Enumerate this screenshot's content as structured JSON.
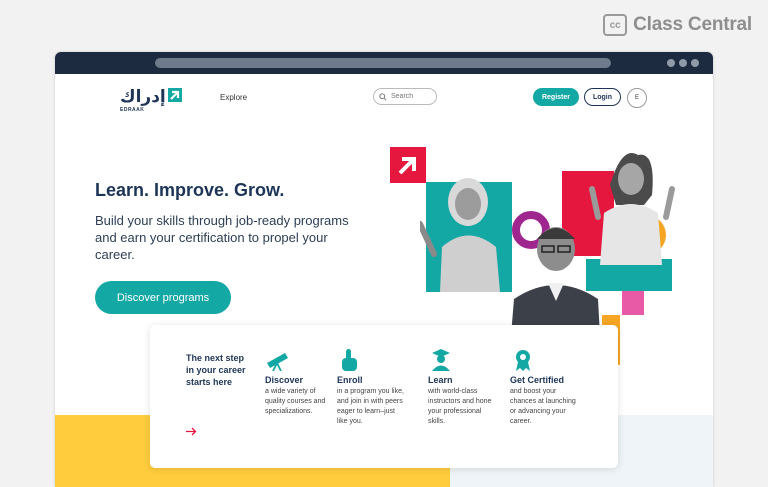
{
  "watermark": {
    "icon": "cc",
    "text": "Class Central"
  },
  "site": {
    "logo_arabic": "إدراك",
    "logo_latin": "EDRAAK",
    "brand_color": "#14a8a5",
    "navy": "#1d3557"
  },
  "nav": {
    "explore": "Explore",
    "search_placeholder": "Search",
    "register": "Register",
    "login": "Login",
    "language": "E"
  },
  "hero": {
    "title": "Learn. Improve. Grow.",
    "subtitle": "Build your skills through job-ready programs and earn your certification to propel your career.",
    "cta": "Discover programs"
  },
  "steps": {
    "intro": "The next step in your career starts here",
    "items": [
      {
        "icon": "telescope-icon",
        "title": "Discover",
        "text": "a wide variety of quality courses and specializations."
      },
      {
        "icon": "pointing-hand-icon",
        "title": "Enroll",
        "text": "in a program you like, and join in with peers eager to learn–just like you."
      },
      {
        "icon": "graduate-icon",
        "title": "Learn",
        "text": "with world-class instructors and hone your professional skills."
      },
      {
        "icon": "award-ribbon-icon",
        "title": "Get Certified",
        "text": "and boost your chances at launching or advancing your career."
      }
    ]
  }
}
